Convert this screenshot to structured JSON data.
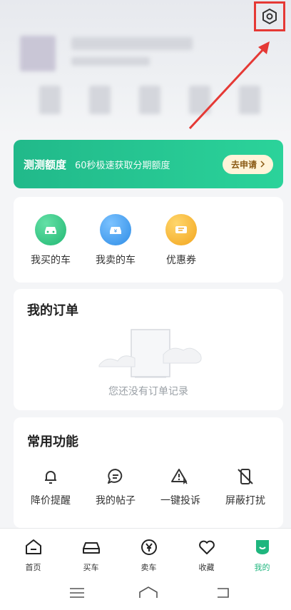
{
  "banner": {
    "title": "测测额度",
    "subtitle": "60秒极速获取分期额度",
    "button": "去申请"
  },
  "quick_actions": [
    {
      "label": "我买的车",
      "icon": "car-icon",
      "color": "#2ec27e"
    },
    {
      "label": "我卖的车",
      "icon": "sell-car-icon",
      "color": "#3b9cf0"
    },
    {
      "label": "优惠券",
      "icon": "coupon-icon",
      "color": "#f4b52a"
    }
  ],
  "orders": {
    "title": "我的订单",
    "empty_text": "您还没有订单记录"
  },
  "functions": {
    "title": "常用功能",
    "items": [
      {
        "label": "降价提醒",
        "icon": "bell-icon"
      },
      {
        "label": "我的帖子",
        "icon": "chat-icon"
      },
      {
        "label": "一键投诉",
        "icon": "warning-icon"
      },
      {
        "label": "屏蔽打扰",
        "icon": "block-phone-icon"
      }
    ]
  },
  "tabbar": {
    "active_color": "#1fb67e",
    "items": [
      {
        "label": "首页",
        "icon": "home-icon"
      },
      {
        "label": "买车",
        "icon": "car-icon"
      },
      {
        "label": "卖车",
        "icon": "yen-icon"
      },
      {
        "label": "收藏",
        "icon": "heart-icon"
      },
      {
        "label": "我的",
        "icon": "profile-icon",
        "active": true
      }
    ]
  },
  "annotation_color": "#e53935"
}
